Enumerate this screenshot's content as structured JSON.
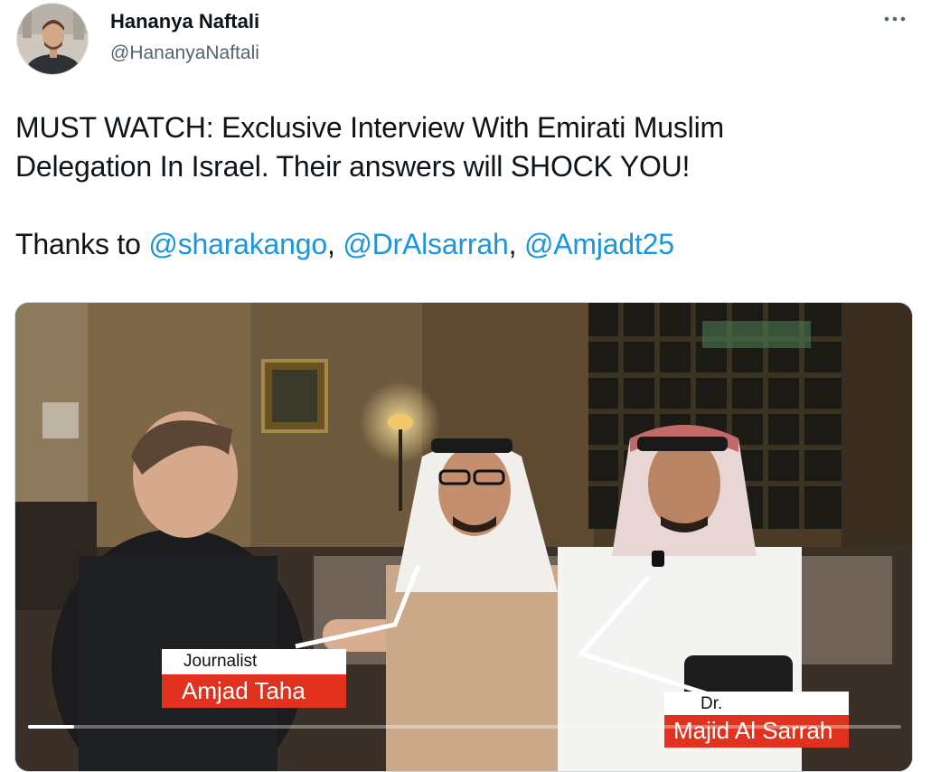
{
  "author": {
    "display_name": "Hananya Naftali",
    "handle": "@HananyaNaftali",
    "avatar_icon": "profile-photo"
  },
  "more_icon": "more-horizontal-icon",
  "tweet": {
    "line1": "MUST WATCH: Exclusive Interview With Emirati Muslim",
    "line2": "Delegation In Israel. Their answers will SHOCK YOU!",
    "thanks_prefix": "Thanks to ",
    "mentions": [
      "@sharakango",
      "@DrAlsarrah",
      "@Amjadt25"
    ],
    "separator": ", "
  },
  "video": {
    "lower_third_1": {
      "title": "Journalist",
      "name": "Amjad Taha"
    },
    "lower_third_2": {
      "title": "Dr.",
      "name": "Majid Al Sarrah"
    },
    "progress": 0.053,
    "accent_color": "#e0321e"
  }
}
